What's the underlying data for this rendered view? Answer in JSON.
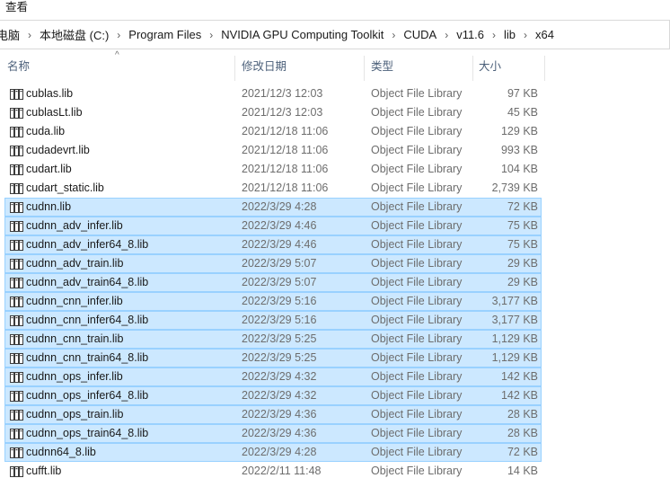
{
  "menu": {
    "view_label": "查看"
  },
  "breadcrumb": {
    "items": [
      "电脑",
      "本地磁盘 (C:)",
      "Program Files",
      "NVIDIA GPU Computing Toolkit",
      "CUDA",
      "v11.6",
      "lib",
      "x64"
    ],
    "separator": "›"
  },
  "columns": {
    "name": "名称",
    "date": "修改日期",
    "type": "类型",
    "size": "大小",
    "sort_indicator": "^"
  },
  "icon": "library-file-icon",
  "files": [
    {
      "name": "cublas.lib",
      "date": "2021/12/3 12:03",
      "type": "Object File Library",
      "size": "97 KB",
      "selected": false
    },
    {
      "name": "cublasLt.lib",
      "date": "2021/12/3 12:03",
      "type": "Object File Library",
      "size": "45 KB",
      "selected": false
    },
    {
      "name": "cuda.lib",
      "date": "2021/12/18 11:06",
      "type": "Object File Library",
      "size": "129 KB",
      "selected": false
    },
    {
      "name": "cudadevrt.lib",
      "date": "2021/12/18 11:06",
      "type": "Object File Library",
      "size": "993 KB",
      "selected": false
    },
    {
      "name": "cudart.lib",
      "date": "2021/12/18 11:06",
      "type": "Object File Library",
      "size": "104 KB",
      "selected": false
    },
    {
      "name": "cudart_static.lib",
      "date": "2021/12/18 11:06",
      "type": "Object File Library",
      "size": "2,739 KB",
      "selected": false
    },
    {
      "name": "cudnn.lib",
      "date": "2022/3/29 4:28",
      "type": "Object File Library",
      "size": "72 KB",
      "selected": true
    },
    {
      "name": "cudnn_adv_infer.lib",
      "date": "2022/3/29 4:46",
      "type": "Object File Library",
      "size": "75 KB",
      "selected": true
    },
    {
      "name": "cudnn_adv_infer64_8.lib",
      "date": "2022/3/29 4:46",
      "type": "Object File Library",
      "size": "75 KB",
      "selected": true
    },
    {
      "name": "cudnn_adv_train.lib",
      "date": "2022/3/29 5:07",
      "type": "Object File Library",
      "size": "29 KB",
      "selected": true
    },
    {
      "name": "cudnn_adv_train64_8.lib",
      "date": "2022/3/29 5:07",
      "type": "Object File Library",
      "size": "29 KB",
      "selected": true
    },
    {
      "name": "cudnn_cnn_infer.lib",
      "date": "2022/3/29 5:16",
      "type": "Object File Library",
      "size": "3,177 KB",
      "selected": true
    },
    {
      "name": "cudnn_cnn_infer64_8.lib",
      "date": "2022/3/29 5:16",
      "type": "Object File Library",
      "size": "3,177 KB",
      "selected": true
    },
    {
      "name": "cudnn_cnn_train.lib",
      "date": "2022/3/29 5:25",
      "type": "Object File Library",
      "size": "1,129 KB",
      "selected": true
    },
    {
      "name": "cudnn_cnn_train64_8.lib",
      "date": "2022/3/29 5:25",
      "type": "Object File Library",
      "size": "1,129 KB",
      "selected": true
    },
    {
      "name": "cudnn_ops_infer.lib",
      "date": "2022/3/29 4:32",
      "type": "Object File Library",
      "size": "142 KB",
      "selected": true
    },
    {
      "name": "cudnn_ops_infer64_8.lib",
      "date": "2022/3/29 4:32",
      "type": "Object File Library",
      "size": "142 KB",
      "selected": true
    },
    {
      "name": "cudnn_ops_train.lib",
      "date": "2022/3/29 4:36",
      "type": "Object File Library",
      "size": "28 KB",
      "selected": true
    },
    {
      "name": "cudnn_ops_train64_8.lib",
      "date": "2022/3/29 4:36",
      "type": "Object File Library",
      "size": "28 KB",
      "selected": true
    },
    {
      "name": "cudnn64_8.lib",
      "date": "2022/3/29 4:28",
      "type": "Object File Library",
      "size": "72 KB",
      "selected": true
    },
    {
      "name": "cufft.lib",
      "date": "2022/2/11 11:48",
      "type": "Object File Library",
      "size": "14 KB",
      "selected": false
    }
  ],
  "colors": {
    "selection_bg": "#cce8ff",
    "selection_border": "#99d1ff",
    "header_text": "#4c607a",
    "meta_text": "#6d6d6d"
  }
}
